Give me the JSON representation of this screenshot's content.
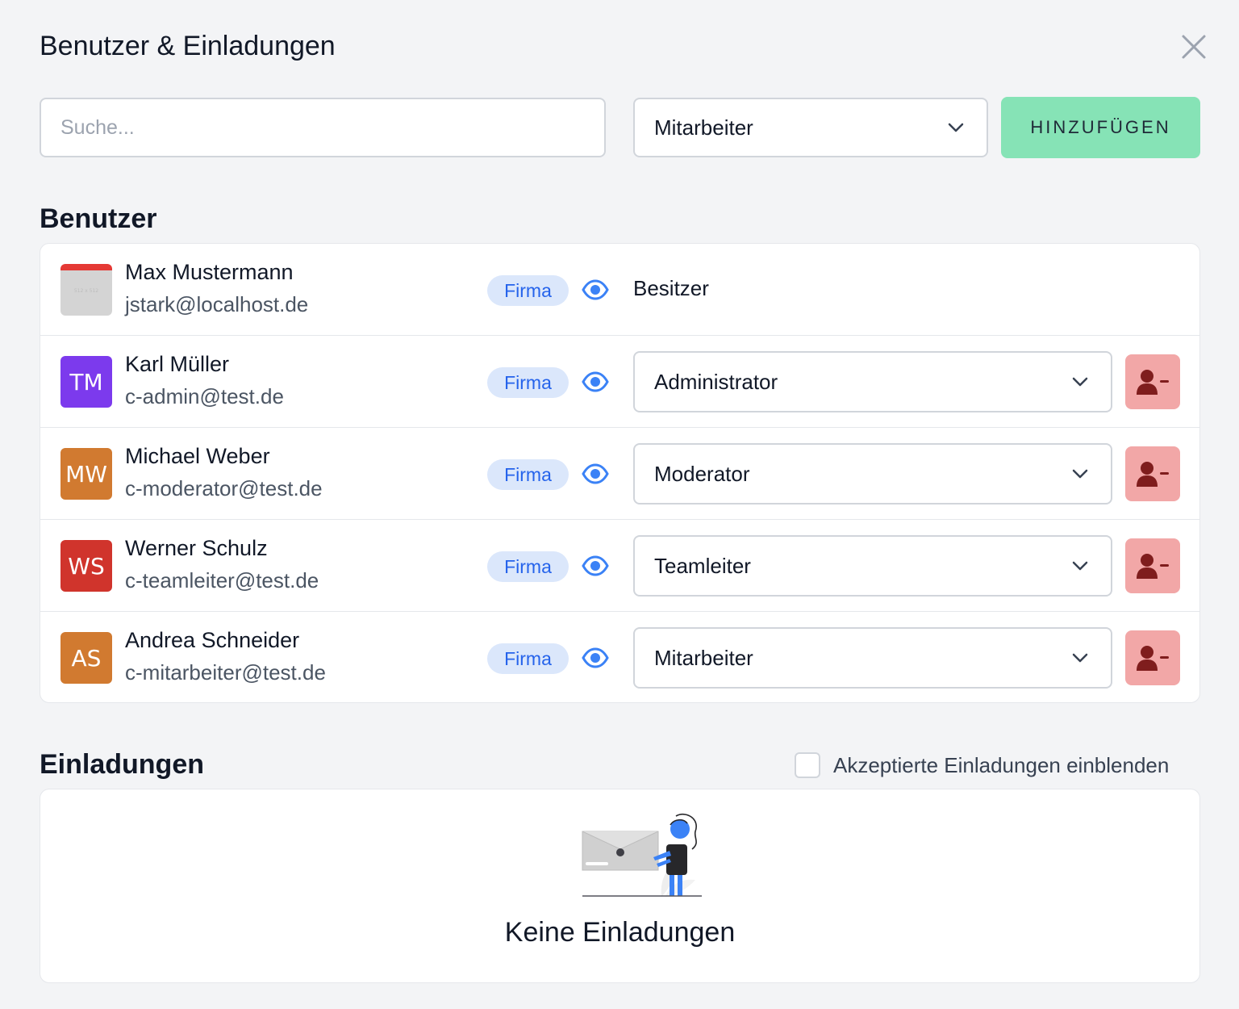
{
  "dialog": {
    "title": "Benutzer & Einladungen"
  },
  "toolbar": {
    "search_placeholder": "Suche...",
    "role_selected": "Mitarbeiter",
    "add_label": "HINZUFÜGEN"
  },
  "users": {
    "heading": "Benutzer",
    "rows": [
      {
        "name": "Max Mustermann",
        "email": "jstark@localhost.de",
        "badge": "Firma",
        "role": "Besitzer",
        "initials": "",
        "avatar_text": "512 x 512",
        "avatar_color": "#d4d4d4"
      },
      {
        "name": "Karl Müller",
        "email": "c-admin@test.de",
        "badge": "Firma",
        "role": "Administrator",
        "initials": "TM",
        "avatar_color": "#7c3aed"
      },
      {
        "name": "Michael Weber",
        "email": "c-moderator@test.de",
        "badge": "Firma",
        "role": "Moderator",
        "initials": "MW",
        "avatar_color": "#d17a30"
      },
      {
        "name": "Werner Schulz",
        "email": "c-teamleiter@test.de",
        "badge": "Firma",
        "role": "Teamleiter",
        "initials": "WS",
        "avatar_color": "#d0342c"
      },
      {
        "name": "Andrea Schneider",
        "email": "c-mitarbeiter@test.de",
        "badge": "Firma",
        "role": "Mitarbeiter",
        "initials": "AS",
        "avatar_color": "#d17a30"
      }
    ]
  },
  "invitations": {
    "heading": "Einladungen",
    "show_accepted_label": "Akzeptierte Einladungen einblenden",
    "show_accepted_checked": false,
    "empty_text": "Keine Einladungen"
  },
  "colors": {
    "accent_green": "#86e3b6",
    "badge_bg": "#dbe7fb",
    "badge_text": "#2563eb",
    "remove_bg": "#f2a7a7",
    "remove_icon": "#7f1d1d"
  },
  "icons": {
    "close": "close-icon",
    "chevron": "chevron-down-icon",
    "eye": "eye-icon",
    "remove_user": "user-minus-icon"
  }
}
